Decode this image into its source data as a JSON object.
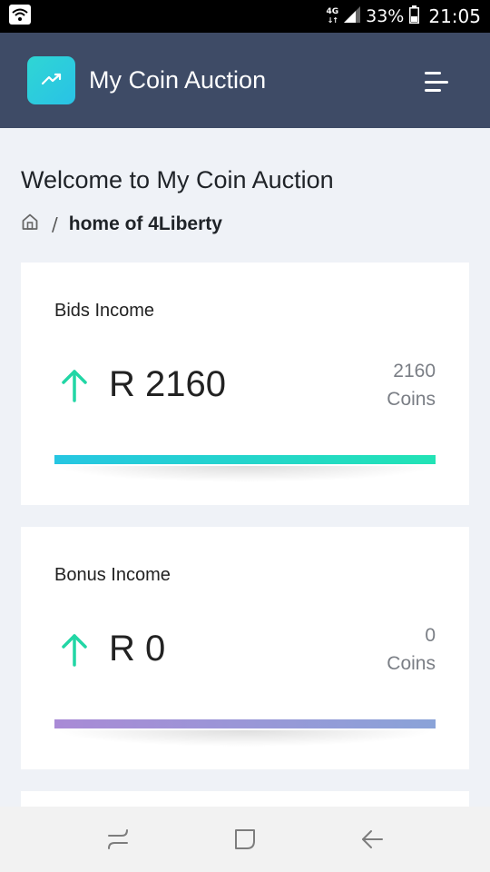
{
  "status_bar": {
    "network": "4G",
    "battery": "33%",
    "time": "21:05"
  },
  "header": {
    "app_title": "My Coin Auction",
    "logo_icon": "trending-up-icon",
    "menu_icon": "menu-icon"
  },
  "page": {
    "title": "Welcome to My Coin Auction",
    "breadcrumb": {
      "home_icon": "home-icon",
      "separator": "/",
      "current": "home of 4Liberty"
    }
  },
  "cards": [
    {
      "label": "Bids Income",
      "amount": "R 2160",
      "coins_value": "2160",
      "coins_label": "Coins",
      "progress": 1.0,
      "bar_colors": [
        "#26c6e2",
        "#22e3b5"
      ],
      "arrow_color": "#22d6a5"
    },
    {
      "label": "Bonus Income",
      "amount": "R 0",
      "coins_value": "0",
      "coins_label": "Coins",
      "progress": 1.0,
      "bar_colors": [
        "#a98ad6",
        "#8aa3d8"
      ],
      "arrow_color": "#22d6a5"
    }
  ],
  "nav": {
    "recent_icon": "recent-apps-icon",
    "home_icon": "home-button-icon",
    "back_icon": "back-icon"
  },
  "colors": {
    "header_bg": "#3e4b66",
    "page_bg": "#eff2f7",
    "accent": "#2fd6d4"
  }
}
